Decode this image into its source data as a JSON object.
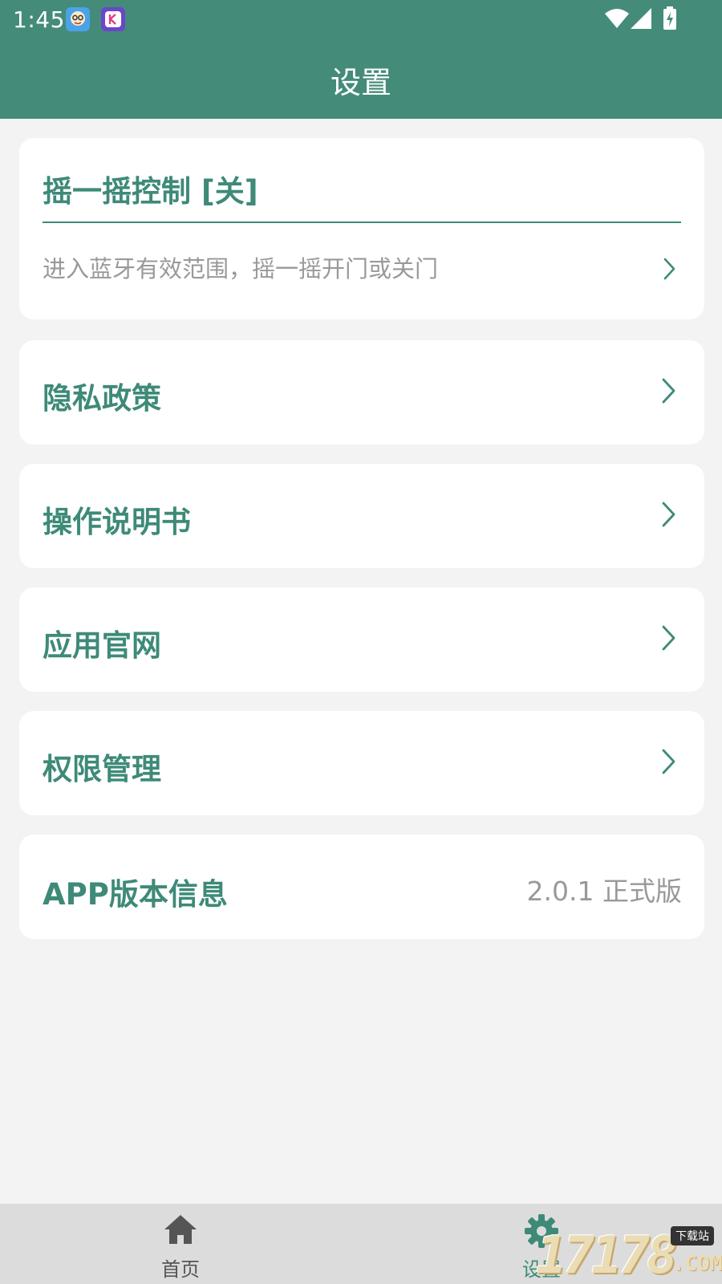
{
  "status_bar": {
    "time": "1:45",
    "notification_icons": [
      "assistant-app-icon",
      "k-app-icon"
    ],
    "indicators": [
      "wifi-icon",
      "cellular-signal-icon",
      "battery-charging-icon"
    ]
  },
  "header": {
    "title": "设置"
  },
  "shake_card": {
    "title": "摇一摇控制 [关]",
    "description": "进入蓝牙有效范围，摇一摇开门或关门"
  },
  "menu": {
    "privacy": "隐私政策",
    "manual": "操作说明书",
    "website": "应用官网",
    "permissions": "权限管理"
  },
  "version": {
    "label": "APP版本信息",
    "value": "2.0.1 正式版"
  },
  "bottom_nav": {
    "home": "首页",
    "settings": "设置",
    "active": "settings"
  },
  "watermark": {
    "digits": "17178",
    "tag": "下载站",
    "suffix": ".COM"
  },
  "colors": {
    "accent": "#448b7a",
    "title_text": "#3e8a78",
    "muted_text": "#999999",
    "background": "#f3f3f3",
    "nav_background": "#dcdcdc"
  }
}
